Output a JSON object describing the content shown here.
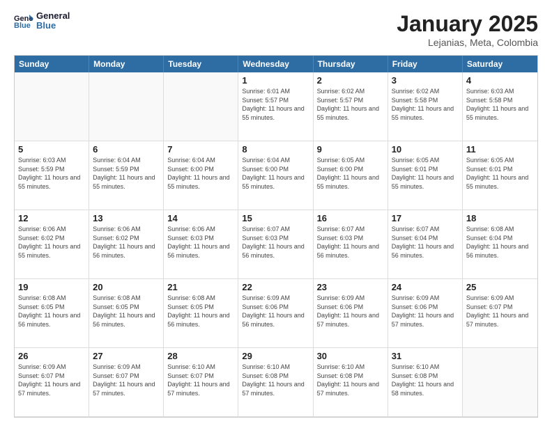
{
  "logo": {
    "line1": "General",
    "line2": "Blue"
  },
  "title": "January 2025",
  "location": "Lejanias, Meta, Colombia",
  "dayHeaders": [
    "Sunday",
    "Monday",
    "Tuesday",
    "Wednesday",
    "Thursday",
    "Friday",
    "Saturday"
  ],
  "weeks": [
    [
      {
        "day": "",
        "info": ""
      },
      {
        "day": "",
        "info": ""
      },
      {
        "day": "",
        "info": ""
      },
      {
        "day": "1",
        "info": "Sunrise: 6:01 AM\nSunset: 5:57 PM\nDaylight: 11 hours\nand 55 minutes."
      },
      {
        "day": "2",
        "info": "Sunrise: 6:02 AM\nSunset: 5:57 PM\nDaylight: 11 hours\nand 55 minutes."
      },
      {
        "day": "3",
        "info": "Sunrise: 6:02 AM\nSunset: 5:58 PM\nDaylight: 11 hours\nand 55 minutes."
      },
      {
        "day": "4",
        "info": "Sunrise: 6:03 AM\nSunset: 5:58 PM\nDaylight: 11 hours\nand 55 minutes."
      }
    ],
    [
      {
        "day": "5",
        "info": "Sunrise: 6:03 AM\nSunset: 5:59 PM\nDaylight: 11 hours\nand 55 minutes."
      },
      {
        "day": "6",
        "info": "Sunrise: 6:04 AM\nSunset: 5:59 PM\nDaylight: 11 hours\nand 55 minutes."
      },
      {
        "day": "7",
        "info": "Sunrise: 6:04 AM\nSunset: 6:00 PM\nDaylight: 11 hours\nand 55 minutes."
      },
      {
        "day": "8",
        "info": "Sunrise: 6:04 AM\nSunset: 6:00 PM\nDaylight: 11 hours\nand 55 minutes."
      },
      {
        "day": "9",
        "info": "Sunrise: 6:05 AM\nSunset: 6:00 PM\nDaylight: 11 hours\nand 55 minutes."
      },
      {
        "day": "10",
        "info": "Sunrise: 6:05 AM\nSunset: 6:01 PM\nDaylight: 11 hours\nand 55 minutes."
      },
      {
        "day": "11",
        "info": "Sunrise: 6:05 AM\nSunset: 6:01 PM\nDaylight: 11 hours\nand 55 minutes."
      }
    ],
    [
      {
        "day": "12",
        "info": "Sunrise: 6:06 AM\nSunset: 6:02 PM\nDaylight: 11 hours\nand 55 minutes."
      },
      {
        "day": "13",
        "info": "Sunrise: 6:06 AM\nSunset: 6:02 PM\nDaylight: 11 hours\nand 56 minutes."
      },
      {
        "day": "14",
        "info": "Sunrise: 6:06 AM\nSunset: 6:03 PM\nDaylight: 11 hours\nand 56 minutes."
      },
      {
        "day": "15",
        "info": "Sunrise: 6:07 AM\nSunset: 6:03 PM\nDaylight: 11 hours\nand 56 minutes."
      },
      {
        "day": "16",
        "info": "Sunrise: 6:07 AM\nSunset: 6:03 PM\nDaylight: 11 hours\nand 56 minutes."
      },
      {
        "day": "17",
        "info": "Sunrise: 6:07 AM\nSunset: 6:04 PM\nDaylight: 11 hours\nand 56 minutes."
      },
      {
        "day": "18",
        "info": "Sunrise: 6:08 AM\nSunset: 6:04 PM\nDaylight: 11 hours\nand 56 minutes."
      }
    ],
    [
      {
        "day": "19",
        "info": "Sunrise: 6:08 AM\nSunset: 6:05 PM\nDaylight: 11 hours\nand 56 minutes."
      },
      {
        "day": "20",
        "info": "Sunrise: 6:08 AM\nSunset: 6:05 PM\nDaylight: 11 hours\nand 56 minutes."
      },
      {
        "day": "21",
        "info": "Sunrise: 6:08 AM\nSunset: 6:05 PM\nDaylight: 11 hours\nand 56 minutes."
      },
      {
        "day": "22",
        "info": "Sunrise: 6:09 AM\nSunset: 6:06 PM\nDaylight: 11 hours\nand 56 minutes."
      },
      {
        "day": "23",
        "info": "Sunrise: 6:09 AM\nSunset: 6:06 PM\nDaylight: 11 hours\nand 57 minutes."
      },
      {
        "day": "24",
        "info": "Sunrise: 6:09 AM\nSunset: 6:06 PM\nDaylight: 11 hours\nand 57 minutes."
      },
      {
        "day": "25",
        "info": "Sunrise: 6:09 AM\nSunset: 6:07 PM\nDaylight: 11 hours\nand 57 minutes."
      }
    ],
    [
      {
        "day": "26",
        "info": "Sunrise: 6:09 AM\nSunset: 6:07 PM\nDaylight: 11 hours\nand 57 minutes."
      },
      {
        "day": "27",
        "info": "Sunrise: 6:09 AM\nSunset: 6:07 PM\nDaylight: 11 hours\nand 57 minutes."
      },
      {
        "day": "28",
        "info": "Sunrise: 6:10 AM\nSunset: 6:07 PM\nDaylight: 11 hours\nand 57 minutes."
      },
      {
        "day": "29",
        "info": "Sunrise: 6:10 AM\nSunset: 6:08 PM\nDaylight: 11 hours\nand 57 minutes."
      },
      {
        "day": "30",
        "info": "Sunrise: 6:10 AM\nSunset: 6:08 PM\nDaylight: 11 hours\nand 57 minutes."
      },
      {
        "day": "31",
        "info": "Sunrise: 6:10 AM\nSunset: 6:08 PM\nDaylight: 11 hours\nand 58 minutes."
      },
      {
        "day": "",
        "info": ""
      }
    ]
  ]
}
